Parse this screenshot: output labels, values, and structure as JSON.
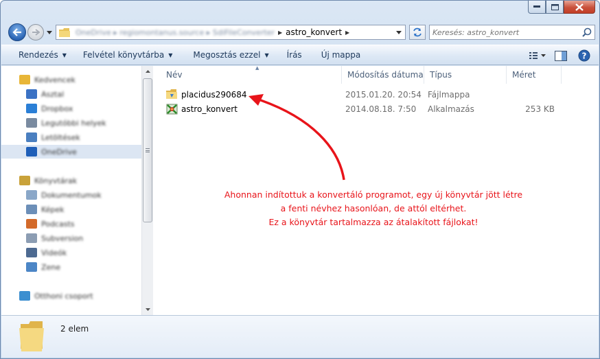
{
  "window": {
    "controls": {
      "minimize": "minimize",
      "maximize": "maximize",
      "close": "close"
    }
  },
  "address": {
    "breadcrumb_hidden": "OneDrive ▸ regiomontanus.source ▸ SdiFileConverter",
    "current": "astro_konvert"
  },
  "search": {
    "placeholder": "Keresés: astro_konvert"
  },
  "toolbar": {
    "organize": "Rendezés",
    "include": "Felvétel könyvtárba",
    "share": "Megosztás ezzel",
    "burn": "Írás",
    "new_folder": "Új mappa"
  },
  "sidebar": {
    "items": [
      {
        "label": "Kedvencek",
        "icon": "star-icon",
        "color": "#e8b638"
      },
      {
        "label": "Asztal",
        "icon": "desktop-icon",
        "color": "#3b72c4"
      },
      {
        "label": "Dropbox",
        "icon": "dropbox-icon",
        "color": "#2b7fd6"
      },
      {
        "label": "Legutóbbi helyek",
        "icon": "recent-places-icon",
        "color": "#7a8ba0"
      },
      {
        "label": "Letöltések",
        "icon": "downloads-icon",
        "color": "#4a7fc0"
      },
      {
        "label": "OneDrive",
        "icon": "onedrive-icon",
        "color": "#1f5fb8"
      },
      {
        "label": "Könyvtárak",
        "icon": "libraries-icon",
        "color": "#c9a23a"
      },
      {
        "label": "Dokumentumok",
        "icon": "documents-icon",
        "color": "#8aa7c8"
      },
      {
        "label": "Képek",
        "icon": "pictures-icon",
        "color": "#6c8fb8"
      },
      {
        "label": "Podcasts",
        "icon": "podcasts-icon",
        "color": "#d36a2a"
      },
      {
        "label": "Subversion",
        "icon": "subversion-icon",
        "color": "#8c9db3"
      },
      {
        "label": "Videók",
        "icon": "videos-icon",
        "color": "#4d6a91"
      },
      {
        "label": "Zene",
        "icon": "music-icon",
        "color": "#4c86c6"
      },
      {
        "label": "Otthoni csoport",
        "icon": "homegroup-icon",
        "color": "#3c8fd0"
      }
    ]
  },
  "columns": {
    "name": "Név",
    "date": "Módosítás dátuma",
    "type": "Típus",
    "size": "Méret"
  },
  "files": [
    {
      "name": "placidus290684",
      "date": "2015.01.20. 20:54",
      "type": "Fájlmappa",
      "size": "",
      "icon": "folder-icon"
    },
    {
      "name": "astro_konvert",
      "date": "2014.08.18. 7:50",
      "type": "Alkalmazás",
      "size": "253 KB",
      "icon": "application-icon"
    }
  ],
  "annotation": {
    "line1": "Ahonnan indítottuk a konvertáló programot, egy új könyvtár jött létre",
    "line2": "a fenti névhez hasonlóan, de attól eltérhet.",
    "line3": "Ez a könyvtár tartalmazza az átalakított fájlokat!",
    "color": "#e8141a"
  },
  "details": {
    "count": "2 elem"
  }
}
